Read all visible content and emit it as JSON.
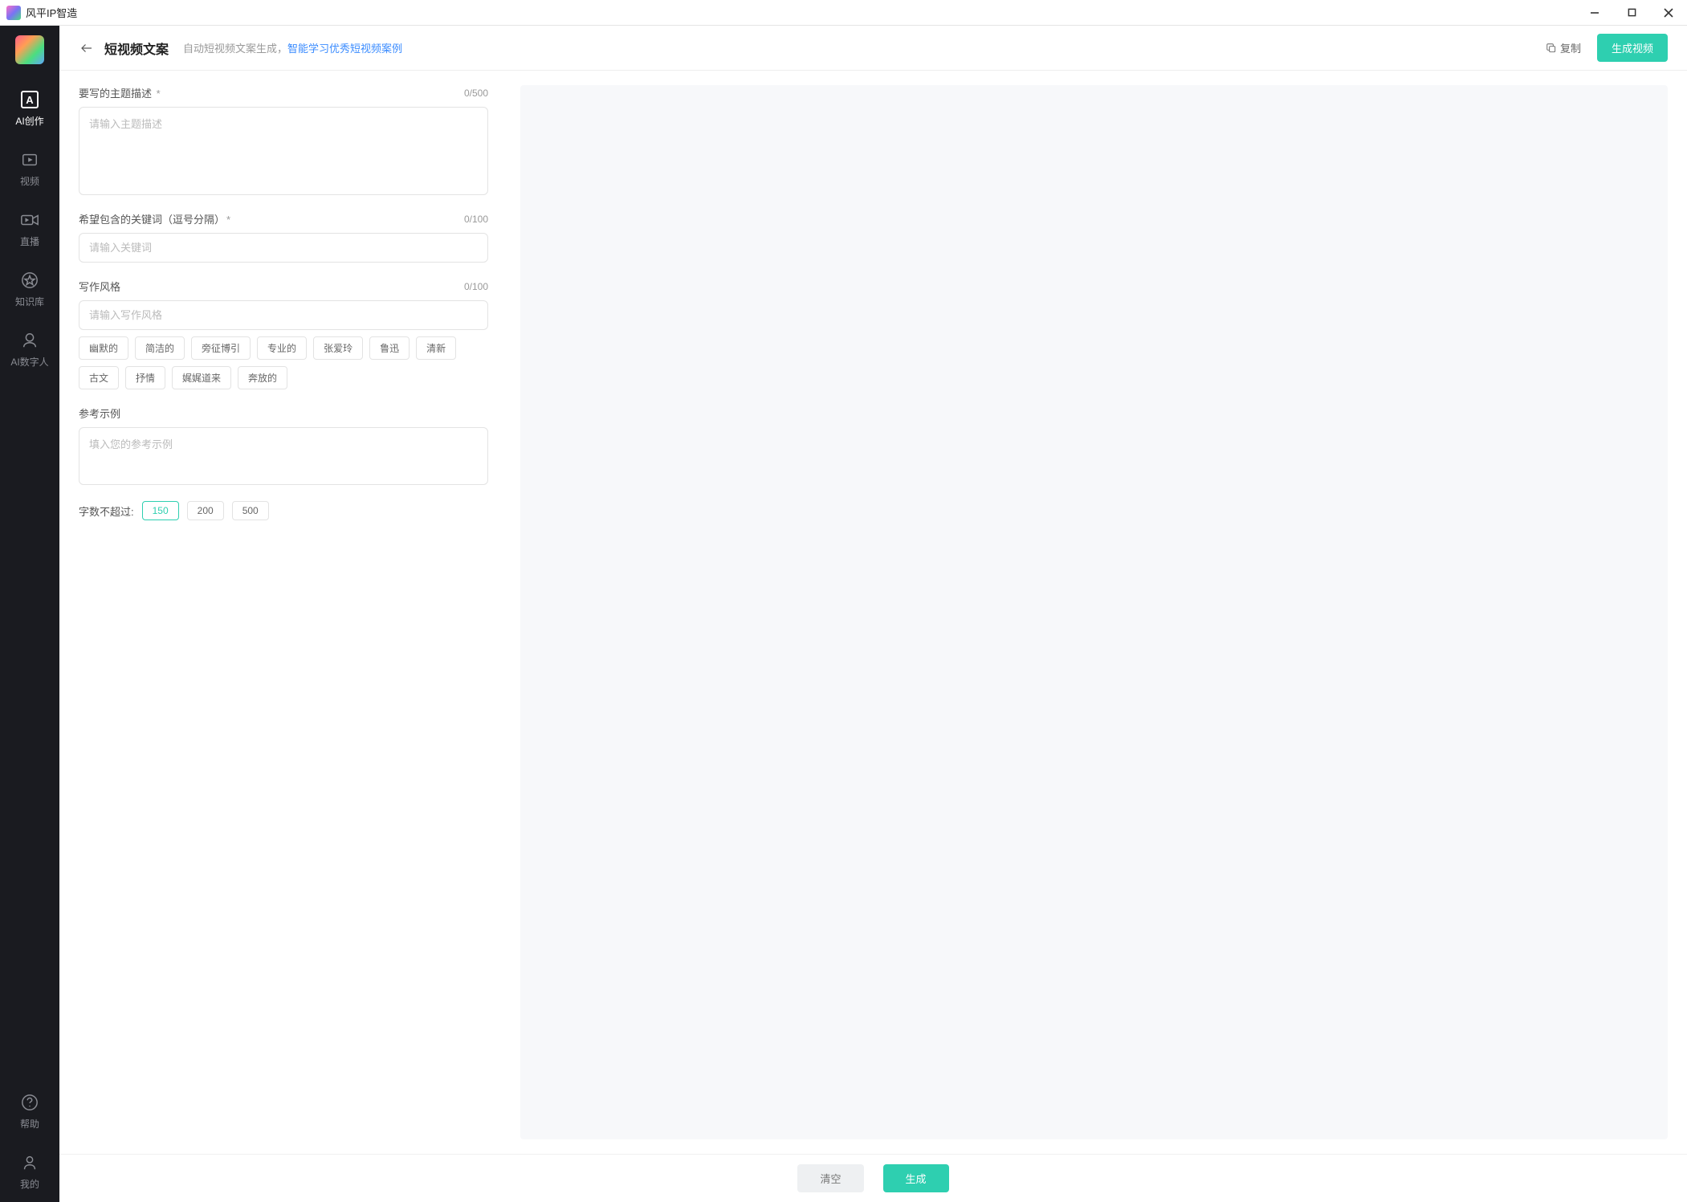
{
  "titlebar": {
    "app_name": "风平IP智造"
  },
  "sidebar": {
    "items": [
      {
        "label": "AI创作",
        "icon": "letter-a-icon"
      },
      {
        "label": "视频",
        "icon": "video-icon"
      },
      {
        "label": "直播",
        "icon": "camera-icon"
      },
      {
        "label": "知识库",
        "icon": "star-icon"
      },
      {
        "label": "AI数字人",
        "icon": "avatar-icon"
      }
    ],
    "footer_items": [
      {
        "label": "帮助",
        "icon": "help-icon"
      },
      {
        "label": "我的",
        "icon": "user-icon"
      }
    ]
  },
  "header": {
    "title": "短视频文案",
    "subtitle_gray": "自动短视频文案生成，",
    "subtitle_blue": "智能学习优秀短视频案例",
    "copy_label": "复制",
    "generate_video_label": "生成视频"
  },
  "form": {
    "topic": {
      "label": "要写的主题描述",
      "required": "*",
      "placeholder": "请输入主题描述",
      "counter": "0/500"
    },
    "keywords": {
      "label": "希望包含的关键词（逗号分隔）",
      "required": "*",
      "placeholder": "请输入关键词",
      "counter": "0/100"
    },
    "style": {
      "label": "写作风格",
      "placeholder": "请输入写作风格",
      "counter": "0/100",
      "tags": [
        "幽默的",
        "简洁的",
        "旁征博引",
        "专业的",
        "张爱玲",
        "鲁迅",
        "清新",
        "古文",
        "抒情",
        "娓娓道来",
        "奔放的"
      ]
    },
    "example": {
      "label": "参考示例",
      "placeholder": "填入您的参考示例"
    },
    "wordlimit": {
      "label": "字数不超过:",
      "options": [
        "150",
        "200",
        "500"
      ],
      "active": "150"
    }
  },
  "footer": {
    "clear_label": "清空",
    "generate_label": "生成"
  }
}
